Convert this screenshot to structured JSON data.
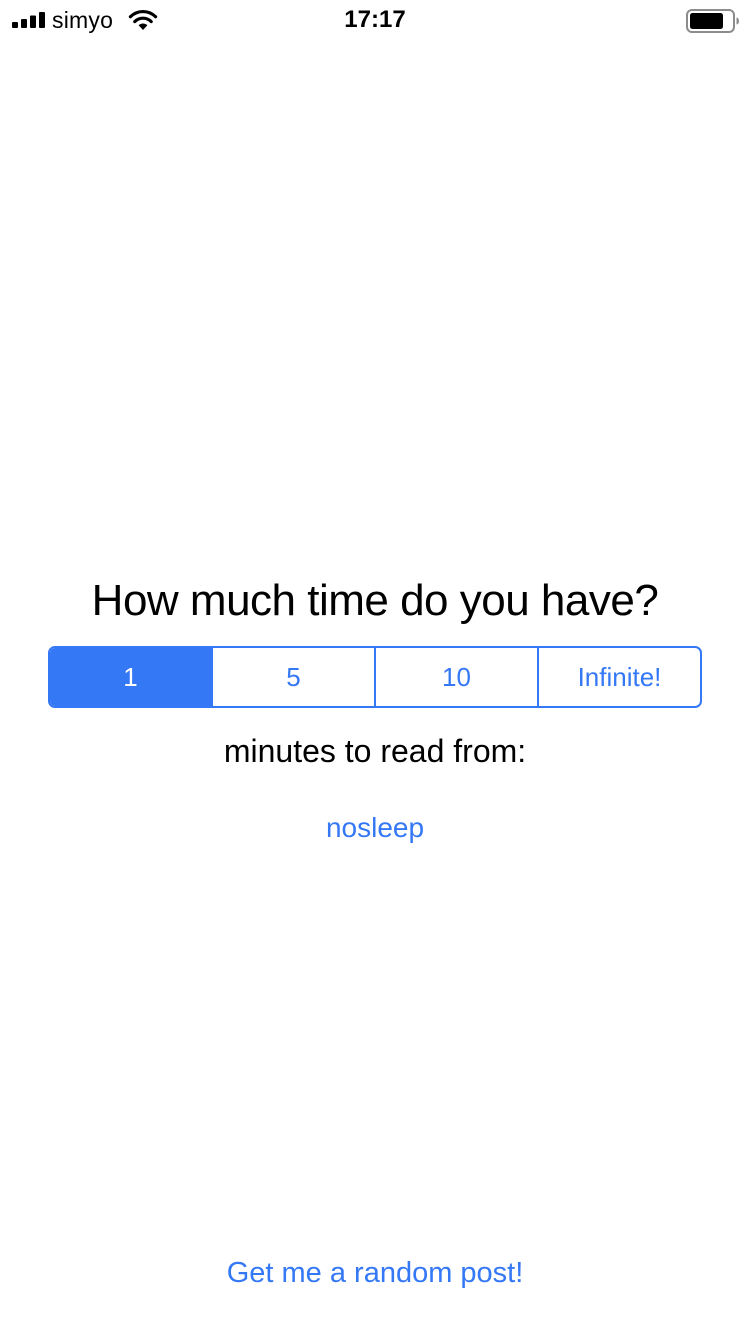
{
  "status_bar": {
    "carrier": "simyo",
    "time": "17:17",
    "signal_bars": 4,
    "battery_level_percent": 80,
    "icons": [
      "signal-icon",
      "wifi-icon",
      "battery-icon"
    ]
  },
  "main": {
    "question": "How much time do you have?",
    "segments": [
      {
        "label": "1",
        "selected": true
      },
      {
        "label": "5",
        "selected": false
      },
      {
        "label": "10",
        "selected": false
      },
      {
        "label": "Infinite!",
        "selected": false
      }
    ],
    "subtitle": "minutes to read from:",
    "subreddit": "nosleep"
  },
  "footer": {
    "random_button_label": "Get me a random post!"
  },
  "colors": {
    "accent": "#3478F6",
    "background": "#FFFFFF",
    "text": "#000000"
  }
}
